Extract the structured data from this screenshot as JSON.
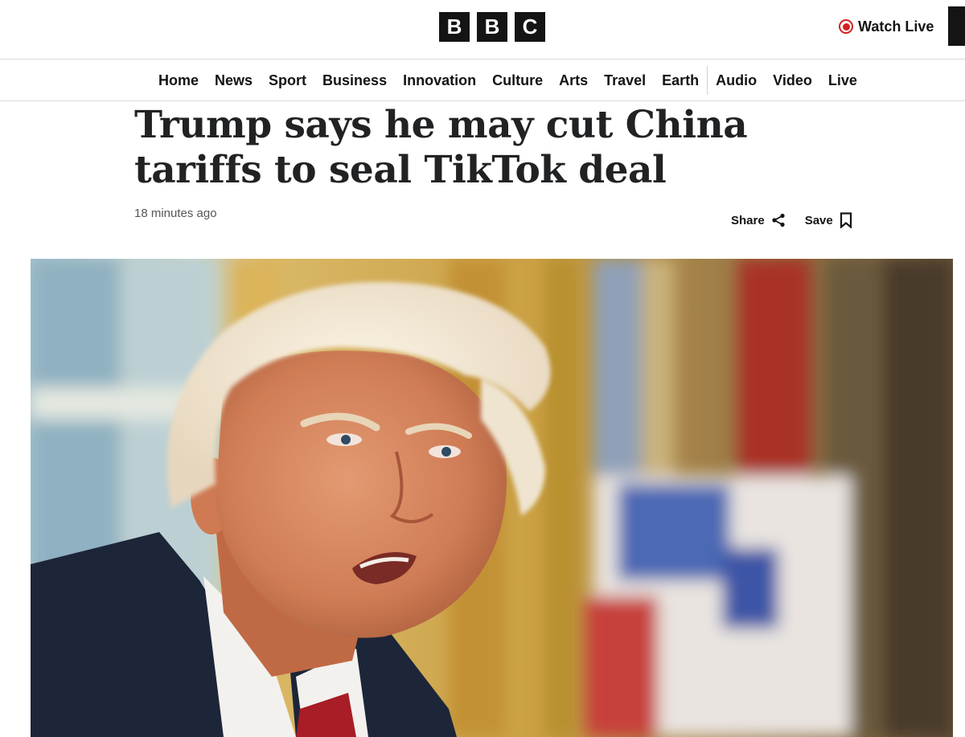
{
  "masthead": {
    "logo_letters": [
      "B",
      "B",
      "C"
    ],
    "watch_live_label": "Watch Live"
  },
  "nav": {
    "items": [
      {
        "label": "Home"
      },
      {
        "label": "News"
      },
      {
        "label": "Sport"
      },
      {
        "label": "Business"
      },
      {
        "label": "Innovation"
      },
      {
        "label": "Culture"
      },
      {
        "label": "Arts"
      },
      {
        "label": "Travel"
      },
      {
        "label": "Earth"
      }
    ],
    "secondary_items": [
      {
        "label": "Audio"
      },
      {
        "label": "Video"
      },
      {
        "label": "Live"
      }
    ]
  },
  "article": {
    "headline": "Trump says he may cut China tariffs to seal TikTok deal",
    "timestamp": "18 minutes ago",
    "share_label": "Share",
    "save_label": "Save"
  },
  "icons": {
    "live": "live-dot-icon",
    "share": "share-icon",
    "save": "bookmark-icon"
  },
  "colors": {
    "live_red": "#d42020",
    "logo_block": "#141414",
    "text": "#141414"
  }
}
